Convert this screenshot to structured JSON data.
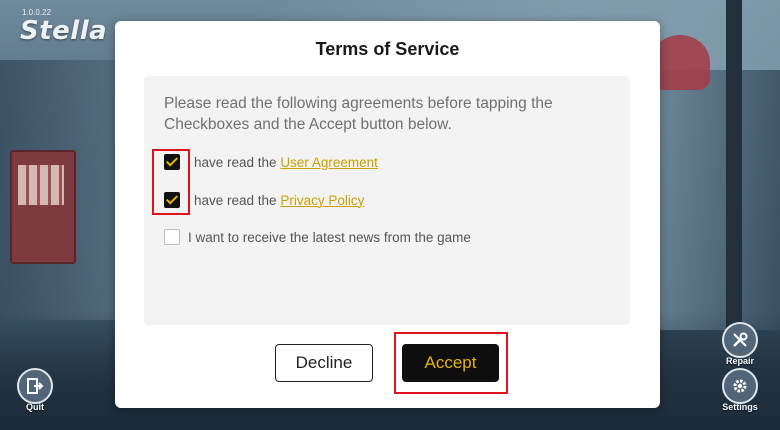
{
  "app": {
    "version": "1.0.0.22",
    "logo_text": "Stella"
  },
  "corner_buttons": {
    "quit": "Quit",
    "repair": "Repair",
    "settings": "Settings"
  },
  "dialog": {
    "title": "Terms of Service",
    "intro": "Please read the following agreements before tapping the Checkboxes and the Accept button below.",
    "items": [
      {
        "prefix": "have read the ",
        "link": "User Agreement",
        "checked": true
      },
      {
        "prefix": "have read the ",
        "link": "Privacy Policy",
        "checked": true
      },
      {
        "text": "I want to receive the latest news from the game",
        "checked": false
      }
    ],
    "decline_label": "Decline",
    "accept_label": "Accept"
  },
  "colors": {
    "accent": "#c9a000",
    "accept_text": "#e8b400",
    "highlight": "#e0121b"
  }
}
